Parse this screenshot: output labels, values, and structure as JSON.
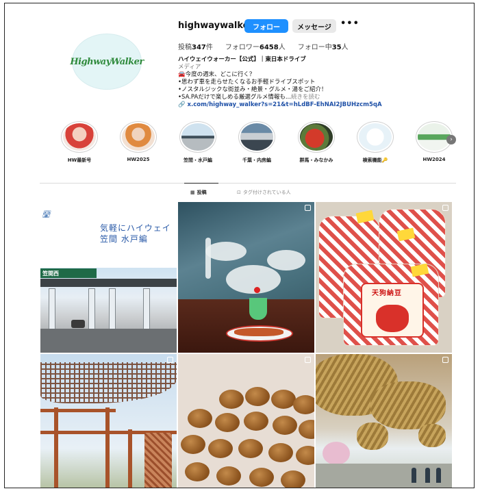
{
  "profile": {
    "avatar_text": "HighwayWalker",
    "username": "highwaywalker",
    "follow_label": "フォロー",
    "message_label": "メッセージ",
    "more_label": "•••",
    "stats": {
      "posts_prefix": "投稿",
      "posts_count": "347",
      "posts_suffix": "件",
      "followers_prefix": "フォロワー",
      "followers_count": "6458",
      "followers_suffix": "人",
      "following_prefix": "フォロー中",
      "following_count": "35",
      "following_suffix": "人"
    },
    "bio": {
      "name": "ハイウェイウォーカー【公式】｜東日本ドライブ",
      "category": "メディア",
      "line1": "🚘今度の週末、どこに行く？",
      "line2": "•思わず車を走らせたくなるお手軽ドライブスポット",
      "line3": "•ノスタルジックな街並み・絶景・グルメ・湯をご紹介！",
      "line4": "•SA.PAだけで楽しめる厳選グルメ情報も...",
      "more": "続きを読む",
      "link": "x.com/highway_walker?s=21&t=hLdBF-EhNAI2JBUHzcm5qA"
    }
  },
  "highlights": {
    "items": [
      {
        "label": "HW最新号"
      },
      {
        "label": "HW2025"
      },
      {
        "label": "笠間・水戸編"
      },
      {
        "label": "千葉・内房編"
      },
      {
        "label": "群馬・みなかみ"
      },
      {
        "label": "検索機能🔑"
      },
      {
        "label": "HW2024"
      }
    ],
    "next_icon": "chevron-right-icon"
  },
  "tabs": {
    "posts_label": "投稿",
    "tagged_label": "タグ付けされている人"
  },
  "grid": {
    "tile1_logo": "🛣",
    "tile1_text_line1": "気軽にハイウェイ",
    "tile1_text_line2": "笠間 水戸編",
    "tile1_sign": "笠間西",
    "tile3_title": "天狗納豆"
  }
}
